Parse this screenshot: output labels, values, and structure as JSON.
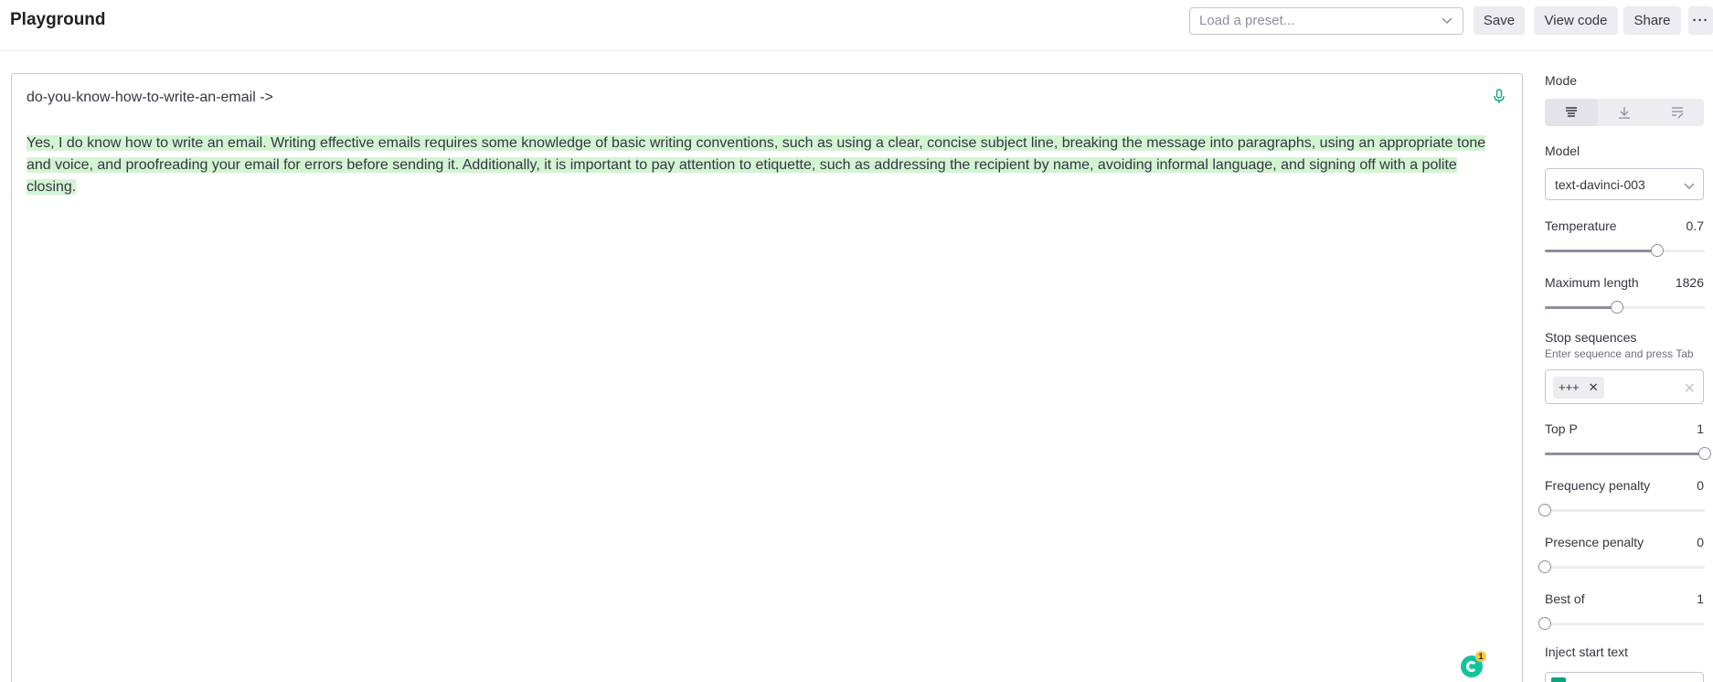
{
  "header": {
    "title": "Playground",
    "preset_placeholder": "Load a preset...",
    "save_label": "Save",
    "view_code_label": "View code",
    "share_label": "Share",
    "more_label": "···"
  },
  "editor": {
    "prompt": "do-you-know-how-to-write-an-email ->",
    "completion": "Yes, I do know how to write an email. Writing effective emails requires some knowledge of basic writing conventions, such as using a clear, concise subject line, breaking the message into paragraphs, using an appropriate tone and voice, and proofreading your email for errors before sending it. Additionally, it is important to pay attention to etiquette, such as addressing the recipient by name, avoiding informal language, and signing off with a polite closing.",
    "completion_highlight_color": "#d2f4d3",
    "grammarly_count": "1"
  },
  "sidebar": {
    "mode_label": "Mode",
    "mode_icons": [
      "complete-icon",
      "insert-icon",
      "edit-icon"
    ],
    "model_label": "Model",
    "model_value": "text-davinci-003",
    "temperature": {
      "label": "Temperature",
      "value": "0.7",
      "fraction": 0.7
    },
    "max_length": {
      "label": "Maximum length",
      "value": "1826",
      "fraction": 0.454
    },
    "stop": {
      "label": "Stop sequences",
      "hint": "Enter sequence and press Tab",
      "chip": "+++"
    },
    "top_p": {
      "label": "Top P",
      "value": "1",
      "fraction": 1.0
    },
    "frequency_penalty": {
      "label": "Frequency penalty",
      "value": "0",
      "fraction": 0.0
    },
    "presence_penalty": {
      "label": "Presence penalty",
      "value": "0",
      "fraction": 0.0
    },
    "best_of": {
      "label": "Best of",
      "value": "1",
      "fraction": 0.0
    },
    "inject_label": "Inject start text",
    "accent_color": "#10a37f"
  }
}
